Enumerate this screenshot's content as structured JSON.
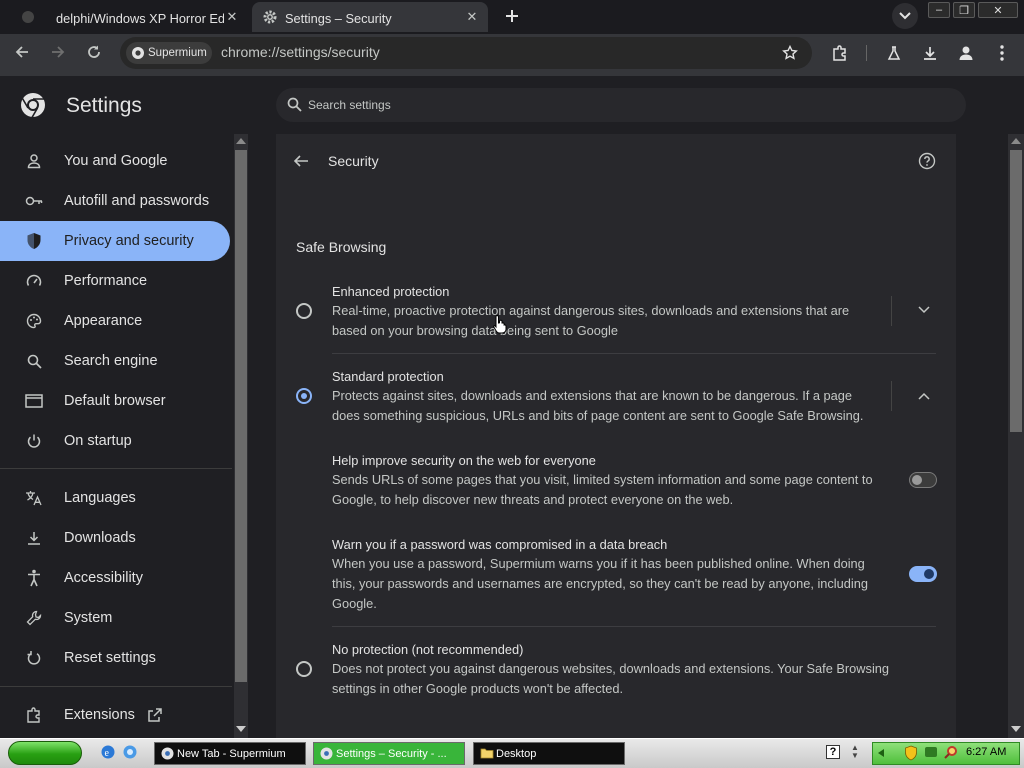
{
  "tabs": [
    {
      "title": "delphi/Windows XP Horror Edition/",
      "active": false
    },
    {
      "title": "Settings – Security",
      "active": true
    }
  ],
  "toolbar": {
    "chip_label": "Supermium",
    "url": "chrome://settings/security"
  },
  "header": {
    "app_title": "Settings",
    "search_placeholder": "Search settings"
  },
  "sidebar": {
    "items": [
      {
        "label": "You and Google",
        "icon": "person-icon"
      },
      {
        "label": "Autofill and passwords",
        "icon": "key-icon"
      },
      {
        "label": "Privacy and security",
        "icon": "shield-icon",
        "active": true
      },
      {
        "label": "Performance",
        "icon": "speedometer-icon"
      },
      {
        "label": "Appearance",
        "icon": "palette-icon"
      },
      {
        "label": "Search engine",
        "icon": "search-icon"
      },
      {
        "label": "Default browser",
        "icon": "browser-window-icon"
      },
      {
        "label": "On startup",
        "icon": "power-icon"
      },
      {
        "label": "Languages",
        "icon": "translate-icon"
      },
      {
        "label": "Downloads",
        "icon": "download-icon"
      },
      {
        "label": "Accessibility",
        "icon": "accessibility-icon"
      },
      {
        "label": "System",
        "icon": "wrench-icon"
      },
      {
        "label": "Reset settings",
        "icon": "reset-icon"
      },
      {
        "label": "Extensions",
        "icon": "extension-icon"
      }
    ]
  },
  "page": {
    "title": "Security",
    "section": "Safe Browsing",
    "options": [
      {
        "title": "Enhanced protection",
        "desc1": "Real-time, proactive protection against dangerous sites, downloads and extensions that are",
        "desc2": "based on your browsing data being sent to Google",
        "selected": false
      },
      {
        "title": "Standard protection",
        "desc1": "Protects against sites, downloads and extensions that are known to be dangerous. If a page",
        "desc2": "does something suspicious, URLs and bits of page content are sent to Google Safe Browsing.",
        "selected": true
      },
      {
        "title": "No protection (not recommended)",
        "desc1": "Does not protect you against dangerous websites, downloads and extensions. Your Safe Browsing",
        "desc2": "settings in other Google products won't be affected.",
        "selected": false
      }
    ],
    "sub_settings": [
      {
        "title": "Help improve security on the web for everyone",
        "desc1": "Sends URLs of some pages that you visit, limited system information and some page content to",
        "desc2": "Google, to help discover new threats and protect everyone on the web.",
        "enabled": false
      },
      {
        "title": "Warn you if a password was compromised in a data breach",
        "desc1": "When you use a password, Supermium warns you if it has been published online. When doing",
        "desc2": "this, your passwords and usernames are encrypted, so they can't be read by anyone, including",
        "desc3": "Google.",
        "enabled": true
      }
    ]
  },
  "taskbar": {
    "tasks": [
      {
        "label": "New Tab - Supermium",
        "active": false
      },
      {
        "label": "Settings – Security - ...",
        "active": true
      },
      {
        "label": "Desktop",
        "active": false
      }
    ],
    "clock": "6:27 AM"
  },
  "colors": {
    "accent": "#8ab4f8",
    "background": "#1f1f23",
    "card": "#28282c"
  }
}
